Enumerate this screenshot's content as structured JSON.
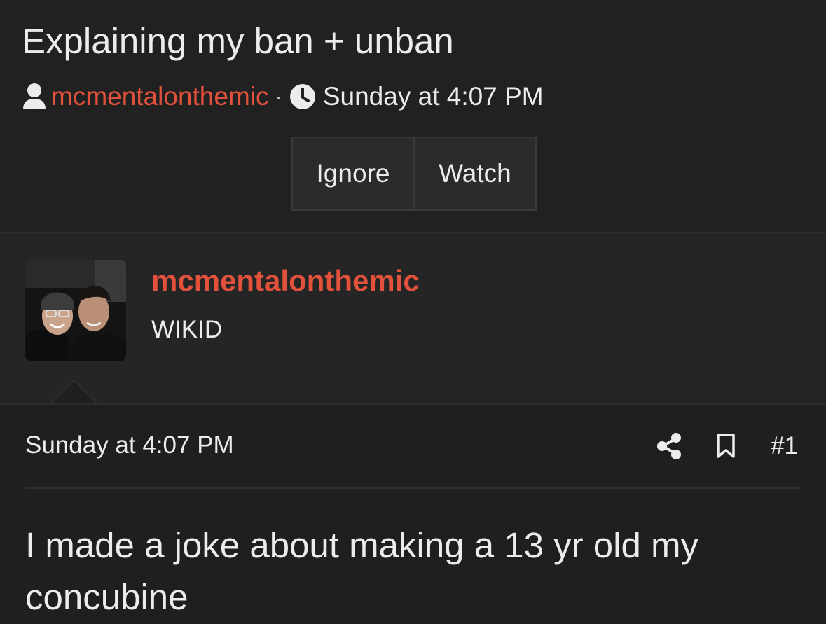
{
  "thread": {
    "title": "Explaining my ban + unban",
    "author": "mcmentalonthemic",
    "separator": "·",
    "date": "Sunday at 4:07 PM"
  },
  "actions": {
    "ignore_label": "Ignore",
    "watch_label": "Watch"
  },
  "post": {
    "username": "mcmentalonthemic",
    "user_title": "WIKID",
    "date": "Sunday at 4:07 PM",
    "number": "#1",
    "body": "I made a joke about making a 13 yr old my concubine"
  },
  "icons": {
    "author": "user-icon",
    "time": "clock-icon",
    "share": "share-icon",
    "bookmark": "bookmark-icon"
  },
  "colors": {
    "accent": "#e2513b",
    "background": "#1f1f1f",
    "text": "#ececec"
  }
}
